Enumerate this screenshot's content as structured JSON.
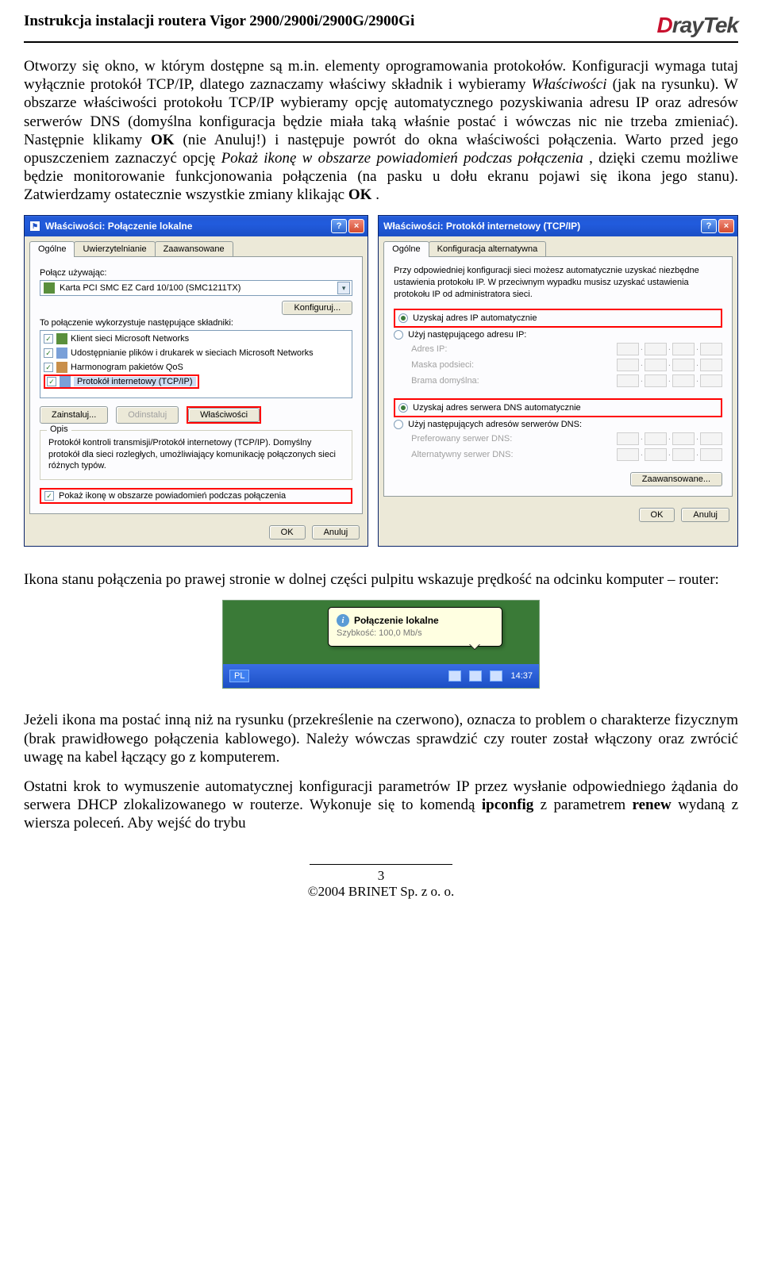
{
  "header": {
    "title": "Instrukcja instalacji routera Vigor 2900/2900i/2900G/2900Gi",
    "logo_prefix": "D",
    "logo_rest": "rayTek"
  },
  "para1": {
    "s1a": "Otworzy się okno, w którym dostępne są m.in. elementy oprogramowania protokołów. Konfiguracji wymaga tutaj wyłącznie protokół TCP/IP, dlatego zaznaczamy właściwy składnik i wybieramy ",
    "s1b": "Właściwości",
    "s1c": " (jak na rysunku). W obszarze właściwości protokołu TCP/IP wybieramy opcję automatycznego pozyskiwania adresu IP oraz adresów serwerów DNS (domyślna konfiguracja będzie miała taką właśnie postać i wówczas nic nie trzeba zmieniać). Następnie klikamy ",
    "s1d": "OK",
    "s1e": " (nie Anuluj!) i następuje powrót do okna właściwości połączenia. Warto przed jego opuszczeniem zaznaczyć opcję ",
    "s1f": "Pokaż ikonę w obszarze powiadomień podczas połączenia",
    "s1g": ", dzięki czemu możliwe będzie monitorowanie funkcjonowania połączenia (na pasku u dołu ekranu pojawi się ikona jego stanu). Zatwierdzamy ostatecznie wszystkie zmiany klikając ",
    "s1h": "OK",
    "s1i": "."
  },
  "dlg1": {
    "title": "Właściwości: Połączenie lokalne",
    "tabs": [
      "Ogólne",
      "Uwierzytelnianie",
      "Zaawansowane"
    ],
    "connect_using": "Połącz używając:",
    "adapter": "Karta PCI SMC EZ Card 10/100 (SMC1211TX)",
    "configure": "Konfiguruj...",
    "components_label": "To połączenie wykorzystuje następujące składniki:",
    "components": [
      "Klient sieci Microsoft Networks",
      "Udostępnianie plików i drukarek w sieciach Microsoft Networks",
      "Harmonogram pakietów QoS",
      "Protokół internetowy (TCP/IP)"
    ],
    "install": "Zainstaluj...",
    "uninstall": "Odinstaluj",
    "properties": "Właściwości",
    "opis_title": "Opis",
    "opis_text": "Protokół kontroli transmisji/Protokół internetowy (TCP/IP). Domyślny protokół dla sieci rozległych, umożliwiający komunikację połączonych sieci różnych typów.",
    "show_icon": "Pokaż ikonę w obszarze powiadomień podczas połączenia",
    "ok": "OK",
    "cancel": "Anuluj"
  },
  "dlg2": {
    "title": "Właściwości: Protokół internetowy (TCP/IP)",
    "tabs": [
      "Ogólne",
      "Konfiguracja alternatywna"
    ],
    "intro": "Przy odpowiedniej konfiguracji sieci możesz automatycznie uzyskać niezbędne ustawienia protokołu IP. W przeciwnym wypadku musisz uzyskać ustawienia protokołu IP od administratora sieci.",
    "r1": "Uzyskaj adres IP automatycznie",
    "r2": "Użyj następującego adresu IP:",
    "f1": "Adres IP:",
    "f2": "Maska podsieci:",
    "f3": "Brama domyślna:",
    "r3": "Uzyskaj adres serwera DNS automatycznie",
    "r4": "Użyj następujących adresów serwerów DNS:",
    "f4": "Preferowany serwer DNS:",
    "f5": "Alternatywny serwer DNS:",
    "advanced": "Zaawansowane...",
    "ok": "OK",
    "cancel": "Anuluj"
  },
  "para2": "Ikona stanu połączenia po prawej stronie w dolnej części pulpitu wskazuje prędkość na odcinku komputer – router:",
  "tray": {
    "balloon_title": "Połączenie lokalne",
    "balloon_sub": "Szybkość: 100,0 Mb/s",
    "lang": "PL",
    "time": "14:37"
  },
  "para3": "Jeżeli ikona ma postać inną niż na rysunku (przekreślenie na czerwono), oznacza to problem o charakterze fizycznym (brak prawidłowego połączenia kablowego). Należy wówczas sprawdzić czy router został włączony oraz zwrócić uwagę na kabel łączący go z komputerem.",
  "para4": {
    "a": "Ostatni krok to wymuszenie automatycznej konfiguracji parametrów IP przez wysłanie odpowiedniego żądania do serwera DHCP zlokalizowanego w routerze. Wykonuje się to komendą ",
    "b": "ipconfig",
    "c": " z parametrem ",
    "d": "renew",
    "e": " wydaną z wiersza poleceń. Aby wejść do trybu"
  },
  "footer": {
    "page": "3",
    "copyright": "©2004 BRINET Sp. z o. o."
  }
}
